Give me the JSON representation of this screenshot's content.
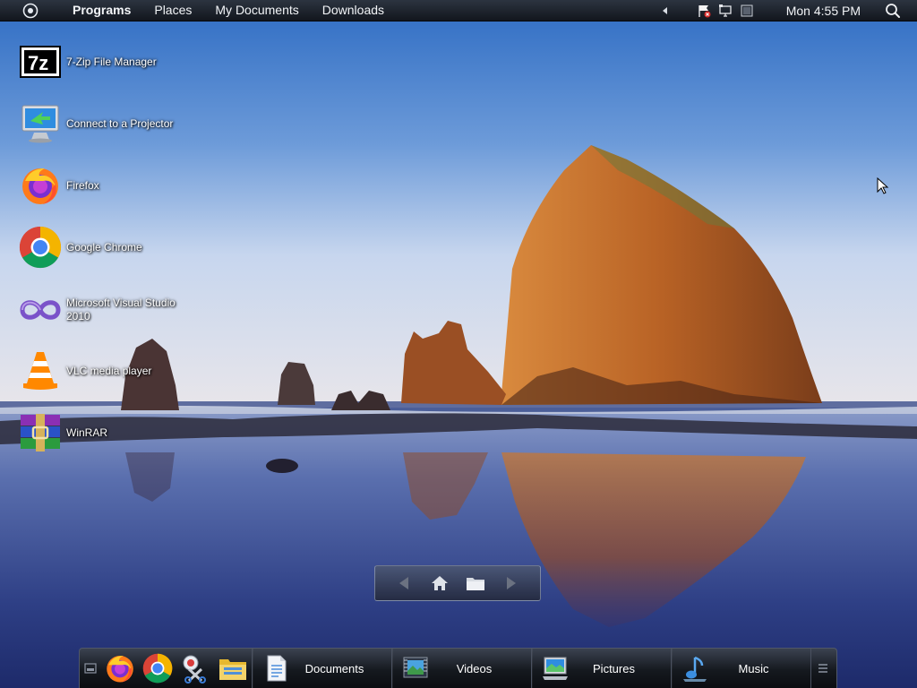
{
  "top_panel": {
    "menu": [
      {
        "label": "Programs",
        "bold": true
      },
      {
        "label": "Places",
        "bold": false
      },
      {
        "label": "My Documents",
        "bold": false
      },
      {
        "label": "Downloads",
        "bold": false
      }
    ],
    "tray_icons": [
      "chevron-left-icon",
      "network-flag-icon",
      "display-icon",
      "battery-icon"
    ],
    "clock": "Mon 4:55 PM",
    "search_icon": "search-icon"
  },
  "desktop": {
    "icons": [
      {
        "label": "7-Zip File Manager",
        "icon": "7zip-icon"
      },
      {
        "label": "Connect to a Projector",
        "icon": "projector-icon"
      },
      {
        "label": "Firefox",
        "icon": "firefox-icon"
      },
      {
        "label": "Google Chrome",
        "icon": "chrome-icon"
      },
      {
        "label": "Microsoft Visual Studio 2010",
        "icon": "visual-studio-icon"
      },
      {
        "label": "VLC media player",
        "icon": "vlc-icon"
      },
      {
        "label": "WinRAR",
        "icon": "winrar-icon"
      }
    ]
  },
  "nav_pill": {
    "buttons": [
      "back-arrow-icon",
      "home-icon",
      "folder-icon",
      "forward-arrow-icon"
    ]
  },
  "dock": {
    "launchers": [
      "firefox-icon",
      "chrome-icon",
      "snipping-tool-icon",
      "file-explorer-icon"
    ],
    "sections": [
      {
        "label": "Documents",
        "icon": "documents-icon"
      },
      {
        "label": "Videos",
        "icon": "videos-icon"
      },
      {
        "label": "Pictures",
        "icon": "pictures-icon"
      },
      {
        "label": "Music",
        "icon": "music-icon"
      }
    ]
  },
  "colors": {
    "panel": "#1a1f27",
    "sky_top": "#2f6fc4",
    "sky_horizon": "#dfe6f2",
    "rock": "#c06a2a",
    "water": "#2a3d7d"
  }
}
